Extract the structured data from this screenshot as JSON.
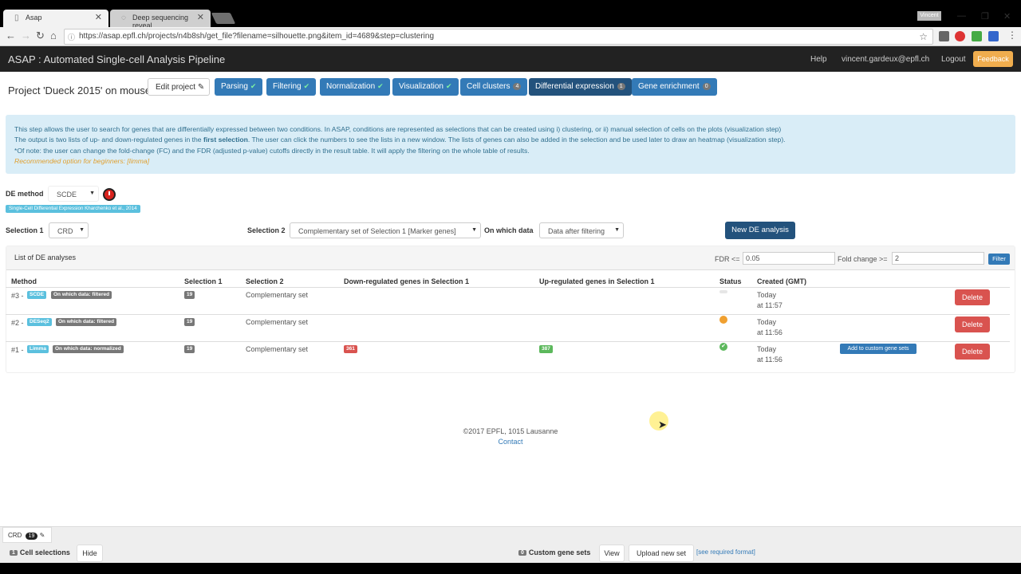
{
  "browser": {
    "tabs": [
      {
        "title": "Asap",
        "active": true
      },
      {
        "title": "Deep sequencing reveal",
        "active": false
      }
    ],
    "profile": "Vincent",
    "url": "https://asap.epfl.ch/projects/n4b8sh/get_file?filename=silhouette.png&item_id=4689&step=clustering"
  },
  "navbar": {
    "brand": "ASAP : Automated Single-cell Analysis Pipeline",
    "help": "Help",
    "user": "vincent.gardeux@epfl.ch",
    "logout": "Logout",
    "feedback": "Feedback"
  },
  "project": {
    "title": "Project 'Dueck 2015' on mouse",
    "edit_label": "Edit project",
    "steps": [
      {
        "label": "Parsing",
        "done": true
      },
      {
        "label": "Filtering",
        "done": true
      },
      {
        "label": "Normalization",
        "done": true
      },
      {
        "label": "Visualization",
        "done": true
      },
      {
        "label": "Cell clusters",
        "count": "4"
      },
      {
        "label": "Differential expression",
        "count": "1"
      },
      {
        "label": "Gene enrichment",
        "count": "0"
      }
    ]
  },
  "info": {
    "line1": "This step allows the user to search for genes that are differentially expressed between two conditions. In ASAP, conditions are represented as selections that can be created using i) clustering, or ii) manual selection of cells on the plots (visualization step)",
    "line2_pre": "The output is two lists of up- and down-regulated genes in the ",
    "line2_bold": "first selection",
    "line2_post": ". The user can click the numbers to see the lists in a new window. The lists of genes can also be added in the selection and be used later to draw an heatmap (visualization step).",
    "line3": "*Of note: the user can change the fold-change (FC) and the FDR (adjusted p-value) cutoffs directly in the result table. It will apply the filtering on the whole table of results.",
    "line4": "Recommended option for beginners: [limma]"
  },
  "form": {
    "de_method_label": "DE method",
    "de_method_value": "SCDE",
    "citation": "Single-Cell Differential Expression Kharchenko et al., 2014",
    "selection1_label": "Selection 1",
    "selection1_value": "CRD",
    "selection2_label": "Selection 2",
    "selection2_value": "Complementary set of Selection 1 [Marker genes]",
    "which_data_label": "On which data",
    "which_data_value": "Data after filtering",
    "new_button": "New DE analysis"
  },
  "list": {
    "title": "List of DE analyses",
    "fdr_label": "FDR <=",
    "fdr_value": "0.05",
    "fc_label": "Fold change >=",
    "fc_value": "2",
    "filter_button": "Filter",
    "headers": [
      "Method",
      "Selection 1",
      "Selection 2",
      "Down-regulated genes in Selection 1",
      "Up-regulated genes in Selection 1",
      "Status",
      "Created (GMT)"
    ],
    "rows": [
      {
        "id": "#3 -",
        "method": "SCDE",
        "data": "On which data: filtered",
        "sel1": "19",
        "sel2": "Complementary set",
        "down": "",
        "up": "",
        "status": "running",
        "date": "Today",
        "time": "at 11:57",
        "delete": "Delete"
      },
      {
        "id": "#2 -",
        "method": "DESeq2",
        "data": "On which data: filtered",
        "sel1": "19",
        "sel2": "Complementary set",
        "down": "",
        "up": "",
        "status": "pending",
        "date": "Today",
        "time": "at 11:56",
        "delete": "Delete"
      },
      {
        "id": "#1 -",
        "method": "Limma",
        "data": "On which data: normalized",
        "sel1": "19",
        "sel2": "Complementary set",
        "down": "361",
        "up": "387",
        "status": "success",
        "date": "Today",
        "time": "at 11:56",
        "add_gene_sets": "Add to custom gene sets",
        "delete": "Delete"
      }
    ],
    "status_colors": {
      "running": "#e6e6e6",
      "pending": "#f0a030",
      "success": "#5cb85c"
    }
  },
  "footer": {
    "copyright": "©2017 EPFL, 1015 Lausanne",
    "contact": "Contact"
  },
  "bottombar": {
    "selection_tag": "CRD",
    "selection_count": "19",
    "cell_sel_count": "1",
    "cell_sel_label": "Cell selections",
    "hide": "Hide",
    "gene_sets_count": "0",
    "gene_sets_label": "Custom gene sets",
    "view": "View",
    "upload": "Upload new set",
    "format_link": "[see required format]"
  }
}
